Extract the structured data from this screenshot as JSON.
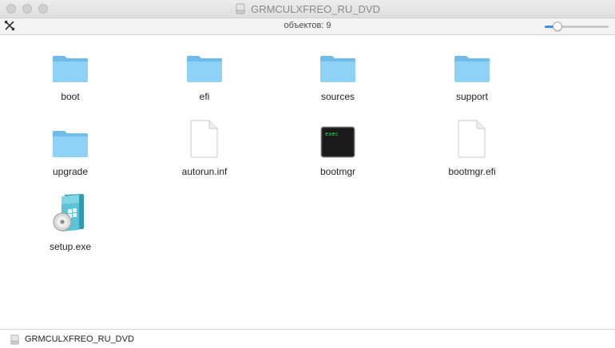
{
  "window": {
    "title": "GRMCULXFREO_RU_DVD"
  },
  "toolbar": {
    "item_count": "объектов: 9",
    "zoom_level": 0.2
  },
  "files": [
    {
      "name": "boot",
      "icon": "folder-icon"
    },
    {
      "name": "efi",
      "icon": "folder-icon"
    },
    {
      "name": "sources",
      "icon": "folder-icon"
    },
    {
      "name": "support",
      "icon": "folder-icon"
    },
    {
      "name": "upgrade",
      "icon": "folder-icon"
    },
    {
      "name": "autorun.inf",
      "icon": "document-icon"
    },
    {
      "name": "bootmgr",
      "icon": "executable-icon",
      "badge": "exec"
    },
    {
      "name": "bootmgr.efi",
      "icon": "document-icon"
    },
    {
      "name": "setup.exe",
      "icon": "installer-icon"
    }
  ],
  "pathbar": {
    "label": "GRMCULXFREO_RU_DVD"
  },
  "colors": {
    "folder": "#7ec8f2",
    "accent": "#3b8fe6",
    "terminal_text": "#3ddc5a"
  }
}
